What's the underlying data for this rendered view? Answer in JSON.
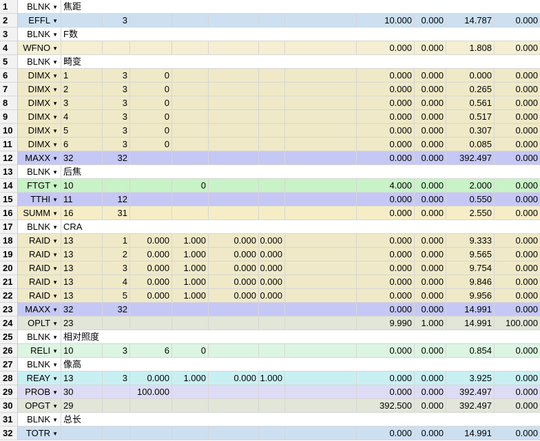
{
  "colors": {
    "BLNK": "#ffffff",
    "EFFL": "#cce0f2",
    "WFNO": "#f4efd2",
    "DIMX": "#efe9c7",
    "MAXX": "#c5c7f5",
    "FTGT": "#c8f3c6",
    "TTHI": "#c5c7f5",
    "SUMM": "#f6edc6",
    "RAID": "#efe9c7",
    "OPLT": "#e2e6d8",
    "RELI": "#dcf5e2",
    "REAY": "#c8f0f3",
    "PROB": "#dedcf5",
    "OPGT": "#e2e6d8",
    "TOTR": "#cce0f2"
  },
  "dropdown_icon": "triangle-down",
  "rows": [
    {
      "num": "1",
      "type": "BLNK",
      "comment": "焦距"
    },
    {
      "num": "2",
      "type": "EFFL",
      "cells": [
        "",
        "3",
        "",
        "",
        "",
        "",
        "",
        "10.000",
        "0.000",
        "14.787",
        "0.000"
      ]
    },
    {
      "num": "3",
      "type": "BLNK",
      "comment": "F数"
    },
    {
      "num": "4",
      "type": "WFNO",
      "cells": [
        "",
        "",
        "",
        "",
        "",
        "",
        "",
        "0.000",
        "0.000",
        "1.808",
        "0.000"
      ]
    },
    {
      "num": "5",
      "type": "BLNK",
      "comment": "畸变"
    },
    {
      "num": "6",
      "type": "DIMX",
      "cells": [
        "1",
        "3",
        "0",
        "",
        "",
        "",
        "",
        "0.000",
        "0.000",
        "0.000",
        "0.000"
      ]
    },
    {
      "num": "7",
      "type": "DIMX",
      "cells": [
        "2",
        "3",
        "0",
        "",
        "",
        "",
        "",
        "0.000",
        "0.000",
        "0.265",
        "0.000"
      ]
    },
    {
      "num": "8",
      "type": "DIMX",
      "cells": [
        "3",
        "3",
        "0",
        "",
        "",
        "",
        "",
        "0.000",
        "0.000",
        "0.561",
        "0.000"
      ]
    },
    {
      "num": "9",
      "type": "DIMX",
      "cells": [
        "4",
        "3",
        "0",
        "",
        "",
        "",
        "",
        "0.000",
        "0.000",
        "0.517",
        "0.000"
      ]
    },
    {
      "num": "10",
      "type": "DIMX",
      "cells": [
        "5",
        "3",
        "0",
        "",
        "",
        "",
        "",
        "0.000",
        "0.000",
        "0.307",
        "0.000"
      ]
    },
    {
      "num": "11",
      "type": "DIMX",
      "cells": [
        "6",
        "3",
        "0",
        "",
        "",
        "",
        "",
        "0.000",
        "0.000",
        "0.085",
        "0.000"
      ]
    },
    {
      "num": "12",
      "type": "MAXX",
      "cells": [
        "32",
        "32",
        "",
        "",
        "",
        "",
        "",
        "0.000",
        "0.000",
        "392.497",
        "0.000"
      ]
    },
    {
      "num": "13",
      "type": "BLNK",
      "comment": "后焦"
    },
    {
      "num": "14",
      "type": "FTGT",
      "cells": [
        "10",
        "",
        "",
        "0",
        "",
        "",
        "",
        "4.000",
        "0.000",
        "2.000",
        "0.000"
      ]
    },
    {
      "num": "15",
      "type": "TTHI",
      "cells": [
        "11",
        "12",
        "",
        "",
        "",
        "",
        "",
        "0.000",
        "0.000",
        "0.550",
        "0.000"
      ]
    },
    {
      "num": "16",
      "type": "SUMM",
      "cells": [
        "16",
        "31",
        "",
        "",
        "",
        "",
        "",
        "0.000",
        "0.000",
        "2.550",
        "0.000"
      ]
    },
    {
      "num": "17",
      "type": "BLNK",
      "comment": "CRA"
    },
    {
      "num": "18",
      "type": "RAID",
      "cells": [
        "13",
        "1",
        "0.000",
        "1.000",
        "0.000",
        "0.000",
        "",
        "0.000",
        "0.000",
        "9.333",
        "0.000"
      ]
    },
    {
      "num": "19",
      "type": "RAID",
      "cells": [
        "13",
        "2",
        "0.000",
        "1.000",
        "0.000",
        "0.000",
        "",
        "0.000",
        "0.000",
        "9.565",
        "0.000"
      ]
    },
    {
      "num": "20",
      "type": "RAID",
      "cells": [
        "13",
        "3",
        "0.000",
        "1.000",
        "0.000",
        "0.000",
        "",
        "0.000",
        "0.000",
        "9.754",
        "0.000"
      ]
    },
    {
      "num": "21",
      "type": "RAID",
      "cells": [
        "13",
        "4",
        "0.000",
        "1.000",
        "0.000",
        "0.000",
        "",
        "0.000",
        "0.000",
        "9.846",
        "0.000"
      ]
    },
    {
      "num": "22",
      "type": "RAID",
      "cells": [
        "13",
        "5",
        "0.000",
        "1.000",
        "0.000",
        "0.000",
        "",
        "0.000",
        "0.000",
        "9.956",
        "0.000"
      ]
    },
    {
      "num": "23",
      "type": "MAXX",
      "cells": [
        "32",
        "32",
        "",
        "",
        "",
        "",
        "",
        "0.000",
        "0.000",
        "14.991",
        "0.000"
      ]
    },
    {
      "num": "24",
      "type": "OPLT",
      "cells": [
        "23",
        "",
        "",
        "",
        "",
        "",
        "",
        "9.990",
        "1.000",
        "14.991",
        "100.000"
      ]
    },
    {
      "num": "25",
      "type": "BLNK",
      "comment": "相对照度"
    },
    {
      "num": "26",
      "type": "RELI",
      "cells": [
        "10",
        "3",
        "6",
        "0",
        "",
        "",
        "",
        "0.000",
        "0.000",
        "0.854",
        "0.000"
      ]
    },
    {
      "num": "27",
      "type": "BLNK",
      "comment": "像高"
    },
    {
      "num": "28",
      "type": "REAY",
      "cells": [
        "13",
        "3",
        "0.000",
        "1.000",
        "0.000",
        "1.000",
        "",
        "0.000",
        "0.000",
        "3.925",
        "0.000"
      ]
    },
    {
      "num": "29",
      "type": "PROB",
      "cells": [
        "30",
        "",
        "100.000",
        "",
        "",
        "",
        "",
        "0.000",
        "0.000",
        "392.497",
        "0.000"
      ]
    },
    {
      "num": "30",
      "type": "OPGT",
      "cells": [
        "29",
        "",
        "",
        "",
        "",
        "",
        "",
        "392.500",
        "0.000",
        "392.497",
        "0.000"
      ]
    },
    {
      "num": "31",
      "type": "BLNK",
      "comment": "总长"
    },
    {
      "num": "32",
      "type": "TOTR",
      "cells": [
        "",
        "",
        "",
        "",
        "",
        "",
        "",
        "0.000",
        "0.000",
        "14.991",
        "0.000"
      ]
    }
  ]
}
